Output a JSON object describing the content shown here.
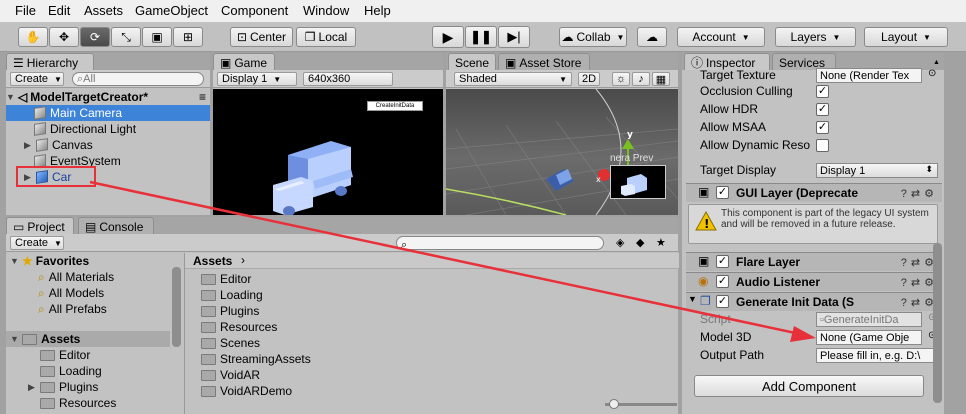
{
  "menu": [
    "File",
    "Edit",
    "Assets",
    "GameObject",
    "Component",
    "Window",
    "Help"
  ],
  "toolbar": {
    "pivot_label": "Center",
    "space_label": "Local",
    "collab_label": "Collab",
    "account_label": "Account",
    "layers_label": "Layers",
    "layout_label": "Layout"
  },
  "hierarchy": {
    "tab_label": "Hierarchy",
    "create_label": "Create",
    "search_placeholder": "All",
    "scene_name": "ModelTargetCreator*",
    "items": [
      {
        "label": "Main Camera"
      },
      {
        "label": "Directional Light"
      },
      {
        "label": "Canvas"
      },
      {
        "label": "EventSystem"
      },
      {
        "label": "Car"
      }
    ]
  },
  "game": {
    "tab_label": "Game",
    "display_label": "Display 1",
    "resolution_label": "640x360",
    "button_label": "CreateInitData"
  },
  "scene": {
    "tab_label": "Scene",
    "asset_store_label": "Asset Store",
    "shading_label": "Shaded",
    "mode_2d_label": "2D",
    "camera_preview_label": "nera Prev"
  },
  "project": {
    "tab_label": "Project",
    "console_label": "Console",
    "create_label": "Create",
    "favorites_label": "Favorites",
    "favorites": [
      "All Materials",
      "All Models",
      "All Prefabs"
    ],
    "assets_label": "Assets",
    "tree_folders": [
      "Editor",
      "Loading",
      "Plugins",
      "Resources"
    ],
    "breadcrumb": "Assets",
    "folders": [
      "Editor",
      "Loading",
      "Plugins",
      "Resources",
      "Scenes",
      "StreamingAssets",
      "VoidAR",
      "VoidARDemo"
    ]
  },
  "inspector": {
    "tab_label": "Inspector",
    "services_label": "Services",
    "camera_rows": [
      {
        "label": "Target Texture",
        "value": "None (Render Tex"
      },
      {
        "label": "Occlusion Culling",
        "checked": true
      },
      {
        "label": "Allow HDR",
        "checked": true
      },
      {
        "label": "Allow MSAA",
        "checked": true
      },
      {
        "label": "Allow Dynamic Reso",
        "checked": false
      },
      {
        "label": "Target Display",
        "value": "Display 1"
      }
    ],
    "gui_layer_title": "GUI Layer (Deprecate",
    "gui_layer_warning": "This component is part of the legacy UI system and will be removed in a future release.",
    "flare_layer_title": "Flare Layer",
    "audio_listener_title": "Audio Listener",
    "generate_title": "Generate Init Data (S",
    "script_label": "Script",
    "script_value": "GenerateInitDa",
    "model_label": "Model 3D",
    "model_value": "None (Game Obje",
    "output_label": "Output Path",
    "output_value": "Please fill in, e.g. D:\\",
    "add_component_label": "Add Component"
  },
  "colors": {
    "selection": "#3d83d7",
    "annotation_red": "#e8303a"
  }
}
